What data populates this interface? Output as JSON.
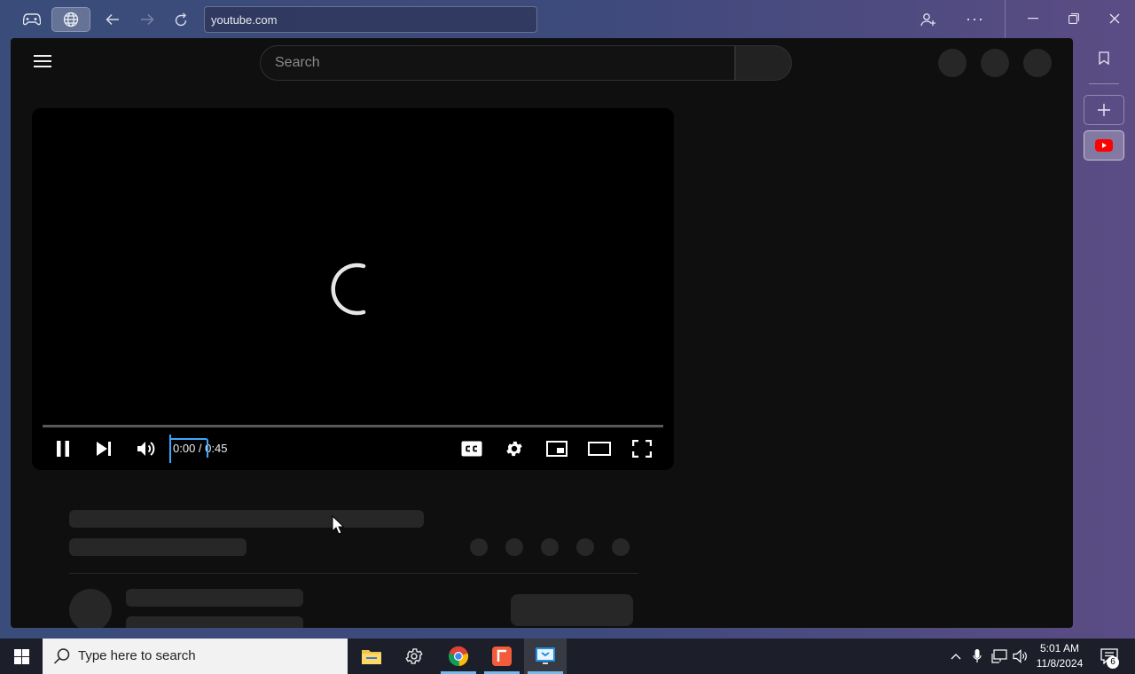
{
  "browser": {
    "address": "youtube.com",
    "tabs": [
      {
        "icon": "gamepad-icon"
      },
      {
        "icon": "globe-icon",
        "active": true
      }
    ]
  },
  "youtube": {
    "search_placeholder": "Search",
    "player": {
      "time": "0:00 / 0:45",
      "progress": 0,
      "state": "loading"
    }
  },
  "sidebar": {
    "items": [
      {
        "icon": "bookmark-icon"
      },
      {
        "icon": "plus-icon"
      },
      {
        "icon": "youtube-icon",
        "active": true
      }
    ]
  },
  "taskbar": {
    "search_placeholder": "Type here to search",
    "time": "5:01 AM",
    "date": "11/8/2024",
    "notification_count": "6",
    "apps": [
      "file-explorer-icon",
      "settings-icon",
      "chrome-icon",
      "app-red-icon",
      "app-blue-icon"
    ]
  },
  "colors": {
    "accent": "#3ea6ff",
    "yt_red": "#ff0000",
    "page_bg": "#0f0f0f"
  }
}
